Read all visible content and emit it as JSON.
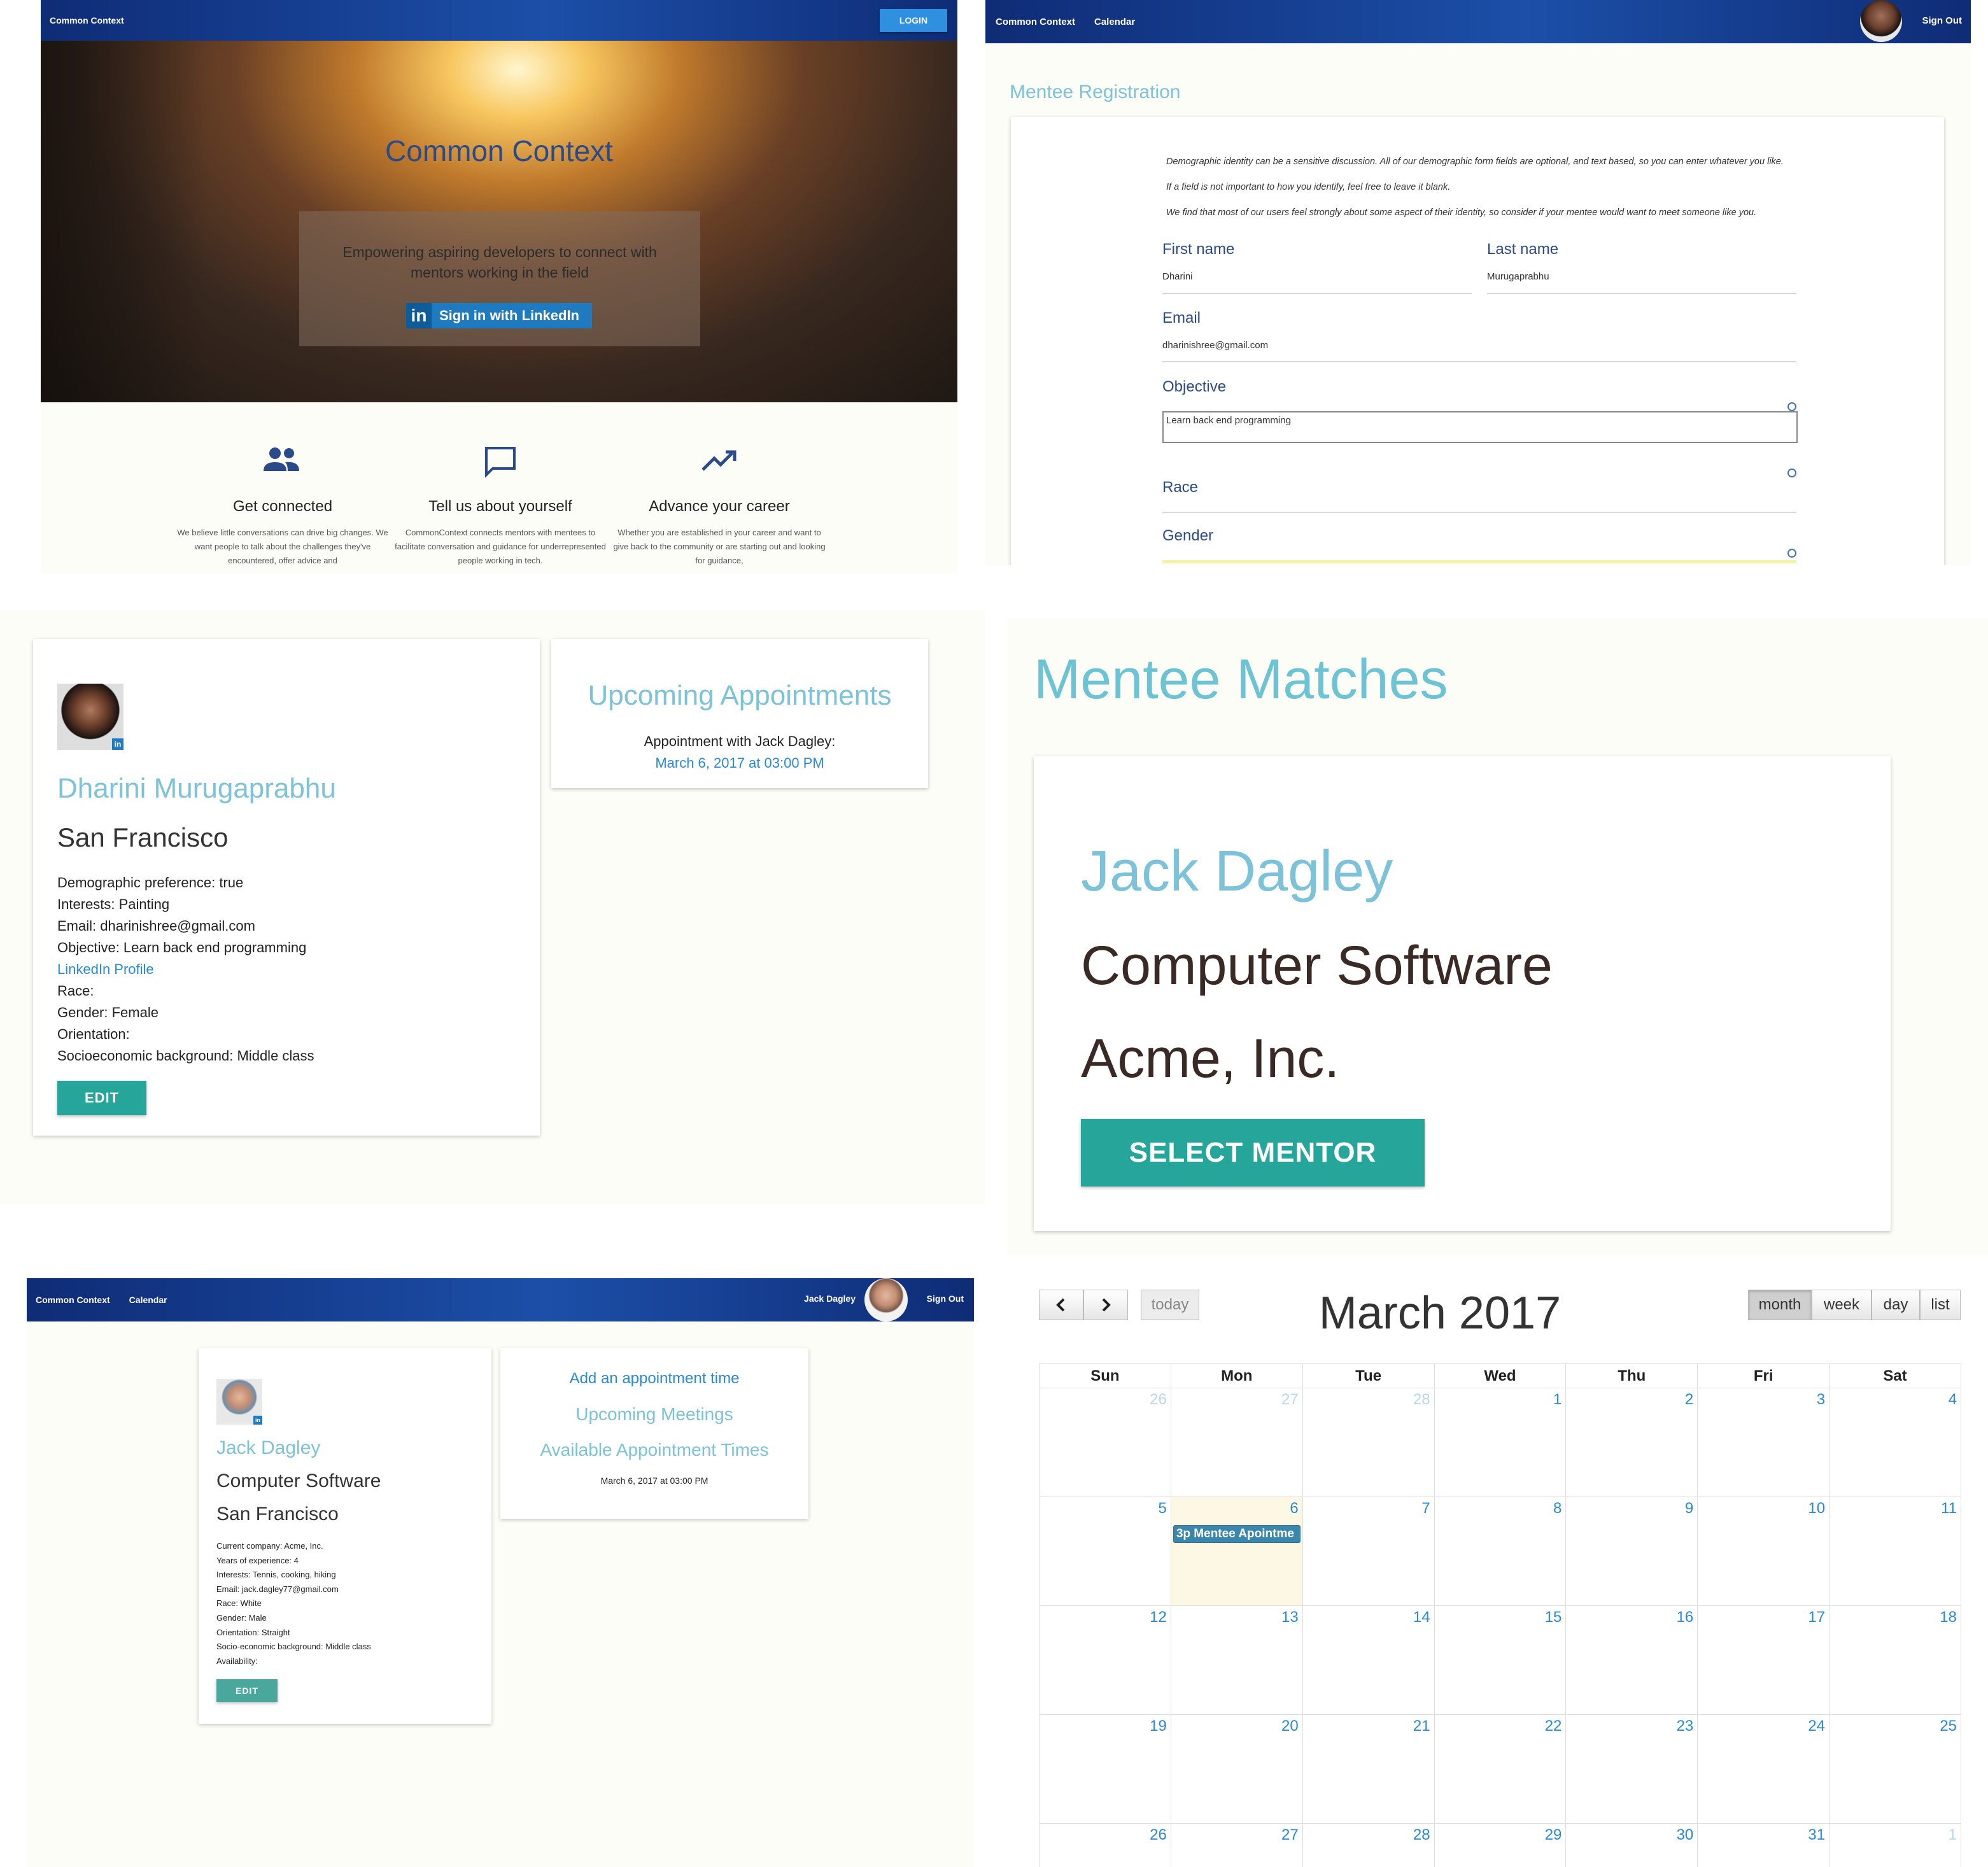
{
  "landing": {
    "brand": "Common Context",
    "login_label": "LOGIN",
    "hero_title": "Common Context",
    "hero_subtitle": "Empowering aspiring developers to connect with mentors working in the field",
    "linkedin_label": "Sign in with LinkedIn",
    "features": [
      {
        "icon": "people-icon",
        "title": "Get connected",
        "text": "We believe little conversations can drive big changes. We want people to talk about the challenges they've encountered, offer advice and"
      },
      {
        "icon": "chat-icon",
        "title": "Tell us about yourself",
        "text": "CommonContext connects mentors with mentees to facilitate conversation and guidance for underrepresented people working in tech."
      },
      {
        "icon": "trending-up-icon",
        "title": "Advance your career",
        "text": "Whether you are established in your career and want to give back to the community or are starting out and looking for guidance,"
      }
    ]
  },
  "registration": {
    "nav_brand": "Common Context",
    "nav_calendar": "Calendar",
    "nav_signout": "Sign Out",
    "title": "Mentee Registration",
    "intro": [
      "Demographic identity can be a sensitive discussion. All of our demographic form fields are optional, and text based, so you can enter whatever you like.",
      "If a field is not important to how you identify, feel free to leave it blank.",
      "We find that most of our users feel strongly about some aspect of their identity, so consider if your mentee would want to meet someone like you."
    ],
    "first_name_label": "First name",
    "first_name_value": "Dharini",
    "last_name_label": "Last name",
    "last_name_value": "Murugaprabhu",
    "email_label": "Email",
    "email_value": "dharinishree@gmail.com",
    "objective_label": "Objective",
    "objective_value": "Learn back end programming",
    "race_label": "Race",
    "gender_label": "Gender"
  },
  "mentee_profile": {
    "name": "Dharini Murugaprabhu",
    "city": "San Francisco",
    "details": [
      "Demographic preference: true",
      "Interests: Painting",
      "Email: dharinishree@gmail.com",
      "Objective: Learn back end programming"
    ],
    "linkedin_link": "LinkedIn Profile",
    "details2": [
      "Race:",
      "Gender: Female",
      "Orientation:",
      "Socioeconomic background: Middle class"
    ],
    "edit_label": "EDIT",
    "appointments_title": "Upcoming Appointments",
    "appointment_text": "Appointment with Jack Dagley:",
    "appointment_time": "March 6, 2017 at 03:00 PM"
  },
  "matches": {
    "title": "Mentee Matches",
    "mentor_name": "Jack Dagley",
    "industry": "Computer Software",
    "company": "Acme, Inc.",
    "select_label": "SELECT MENTOR"
  },
  "mentor_profile": {
    "nav_brand": "Common Context",
    "nav_calendar": "Calendar",
    "nav_user": "Jack Dagley",
    "nav_signout": "Sign Out",
    "name": "Jack Dagley",
    "industry": "Computer Software",
    "city": "San Francisco",
    "details": [
      "Current company: Acme, Inc.",
      "Years of experience: 4",
      "Interests: Tennis, cooking, hiking",
      "Email: jack.dagley77@gmail.com",
      "Race: White",
      "Gender: Male",
      "Orientation: Straight",
      "Socio-economic background: Middle class",
      "Availability:"
    ],
    "edit_label": "EDIT",
    "add_appointment": "Add an appointment time",
    "upcoming_meetings": "Upcoming Meetings",
    "available_times": "Available Appointment Times",
    "available_time_value": "March 6, 2017 at 03:00 PM"
  },
  "calendar": {
    "title": "March 2017",
    "today_label": "today",
    "views": [
      "month",
      "week",
      "day",
      "list"
    ],
    "active_view": "month",
    "weekdays": [
      "Sun",
      "Mon",
      "Tue",
      "Wed",
      "Thu",
      "Fri",
      "Sat"
    ],
    "weeks": [
      [
        "26",
        "27",
        "28",
        "1",
        "2",
        "3",
        "4"
      ],
      [
        "5",
        "6",
        "7",
        "8",
        "9",
        "10",
        "11"
      ],
      [
        "12",
        "13",
        "14",
        "15",
        "16",
        "17",
        "18"
      ],
      [
        "19",
        "20",
        "21",
        "22",
        "23",
        "24",
        "25"
      ],
      [
        "26",
        "27",
        "28",
        "29",
        "30",
        "31",
        "1"
      ]
    ],
    "highlight_day": "6",
    "event_label": "3p Mentee Apointme",
    "accent_color": "#3a87ad",
    "today_bg": "#fcf8e3"
  }
}
